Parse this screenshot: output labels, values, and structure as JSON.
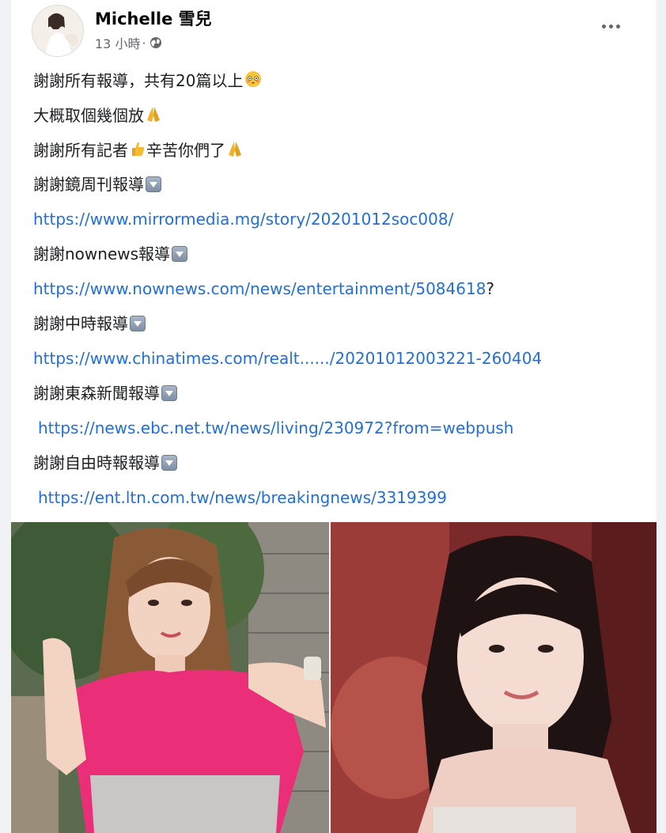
{
  "post": {
    "author": "Michelle 雪兒",
    "timestamp": "13 小時",
    "separator": "·",
    "privacy_icon": "globe-icon",
    "more_icon": "more-horizontal-icon",
    "lines": [
      {
        "text": "謝謝所有報導，共有20篇以上",
        "emoji": "flushed-face-icon"
      },
      {
        "text": "大概取個幾個放",
        "emoji": "folded-hands-icon"
      },
      {
        "text": "謝謝所有記者",
        "emoji": "thumbs-up-icon",
        "text2": "辛苦你們了",
        "emoji2": "folded-hands-icon"
      },
      {
        "text": "謝謝鏡周刊報導",
        "emoji": "down-arrow-icon"
      },
      {
        "link": "https://www.mirrormedia.mg/story/20201012soc008/"
      },
      {
        "text": "謝謝nownews報導",
        "emoji": "down-arrow-icon"
      },
      {
        "link": "https://www.nownews.com/news/entertainment/5084618",
        "suffix": "?"
      },
      {
        "text": "謝謝中時報導",
        "emoji": "down-arrow-icon"
      },
      {
        "link": "https://www.chinatimes.com/realt....../20201012003221-260404"
      },
      {
        "text": "謝謝東森新聞報導",
        "emoji": "down-arrow-icon"
      },
      {
        "link": "https://news.ebc.net.tw/news/living/230972?from=webpush"
      },
      {
        "text": "謝謝自由時報報導",
        "emoji": "down-arrow-icon"
      },
      {
        "link": "https://ent.ltn.com.tw/news/breakingnews/3319399"
      }
    ],
    "colors": {
      "link": "#216fdb",
      "meta": "#65676b",
      "text": "#1c1e21"
    }
  }
}
